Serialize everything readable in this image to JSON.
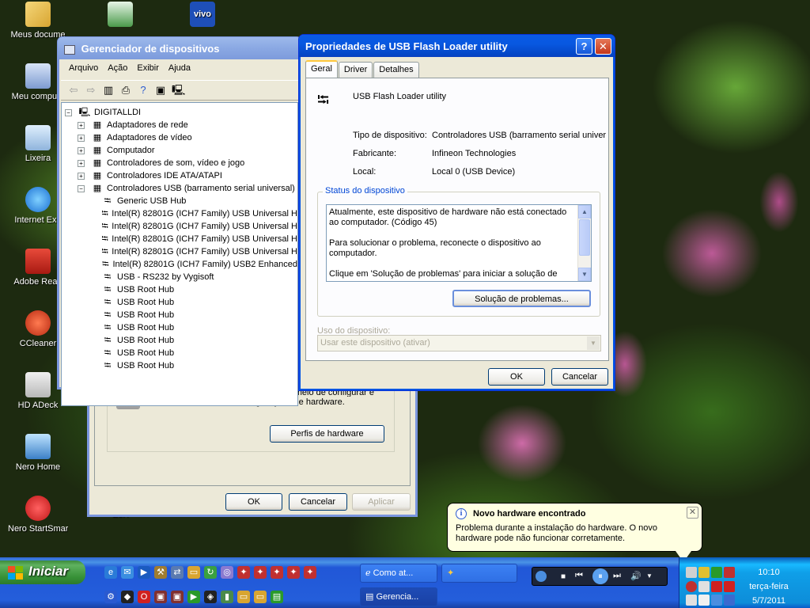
{
  "desktop": {
    "icons": [
      {
        "label": "Meus docume"
      },
      {
        "label": "Meu computa"
      },
      {
        "label": "Lixeira"
      },
      {
        "label": "Internet Exp"
      },
      {
        "label": "Adobe Read"
      },
      {
        "label": "CCleaner"
      },
      {
        "label": "HD ADeck"
      },
      {
        "label": "Nero Home"
      },
      {
        "label": "Nero StartSmart"
      },
      {
        "label": "Z3X"
      }
    ],
    "top_icons": [
      {
        "label": "vivo"
      }
    ]
  },
  "device_manager": {
    "title": "Gerenciador de dispositivos",
    "menu": [
      "Arquivo",
      "Ação",
      "Exibir",
      "Ajuda"
    ],
    "root": "DIGITALLDI",
    "tree": [
      {
        "label": "Adaptadores de rede",
        "level": 1
      },
      {
        "label": "Adaptadores de vídeo",
        "level": 1
      },
      {
        "label": "Computador",
        "level": 1
      },
      {
        "label": "Controladores de som, vídeo e jogo",
        "level": 1
      },
      {
        "label": "Controladores IDE ATA/ATAPI",
        "level": 1
      },
      {
        "label": "Controladores USB (barramento serial universal)",
        "level": 1,
        "expanded": true
      },
      {
        "label": "Generic USB Hub",
        "level": 2
      },
      {
        "label": "Intel(R) 82801G (ICH7 Family) USB Universal H",
        "level": 2
      },
      {
        "label": "Intel(R) 82801G (ICH7 Family) USB Universal H",
        "level": 2
      },
      {
        "label": "Intel(R) 82801G (ICH7 Family) USB Universal H",
        "level": 2
      },
      {
        "label": "Intel(R) 82801G (ICH7 Family) USB Universal H",
        "level": 2
      },
      {
        "label": "Intel(R) 82801G (ICH7 Family) USB2 Enhanced",
        "level": 2
      },
      {
        "label": "USB - RS232 by Vygisoft",
        "level": 2
      },
      {
        "label": "USB Root Hub",
        "level": 2
      },
      {
        "label": "USB Root Hub",
        "level": 2
      },
      {
        "label": "USB Root Hub",
        "level": 2
      },
      {
        "label": "USB Root Hub",
        "level": 2
      },
      {
        "label": "USB Root Hub",
        "level": 2
      },
      {
        "label": "USB Root Hub",
        "level": 2
      },
      {
        "label": "USB Root Hub",
        "level": 2
      }
    ]
  },
  "system_props": {
    "text_line1": "Os Perfis de hardware fornecem um meio de configurar e",
    "text_line2": "armazenar diferentes configurações de hardware.",
    "profiles_button": "Perfis de hardware",
    "ok": "OK",
    "cancel": "Cancelar",
    "apply": "Aplicar"
  },
  "usb_props": {
    "title": "Propriedades de USB Flash Loader utility",
    "tabs": [
      "Geral",
      "Driver",
      "Detalhes"
    ],
    "device_name": "USB Flash Loader utility",
    "fields": [
      {
        "label": "Tipo de dispositivo:",
        "value": "Controladores USB (barramento serial univers"
      },
      {
        "label": "Fabricante:",
        "value": "Infineon Technologies"
      },
      {
        "label": "Local:",
        "value": "Local 0 (USB Device)"
      }
    ],
    "status_legend": "Status do dispositivo",
    "status_p1": "Atualmente, este dispositivo de hardware não está conectado ao computador. (Código 45)",
    "status_p2": "Para solucionar o problema, reconecte o dispositivo ao computador.",
    "status_p3": "Clique em 'Solução de problemas' para iniciar a solução de",
    "troubleshoot_button": "Solução de problemas...",
    "usage_label": "Uso do dispositivo:",
    "usage_value": "Usar este dispositivo (ativar)",
    "ok": "OK",
    "cancel": "Cancelar"
  },
  "balloon": {
    "title": "Novo hardware encontrado",
    "text": "Problema durante a instalação do hardware. O novo hardware pode não funcionar corretamente."
  },
  "taskbar": {
    "start_label": "Iniciar",
    "tasks": [
      {
        "label": "Como at..."
      },
      {
        "label": ""
      },
      {
        "label": "Gerencia..."
      }
    ],
    "clock_time": "10:10",
    "clock_day": "terça-feira",
    "clock_date": "5/7/2011"
  }
}
